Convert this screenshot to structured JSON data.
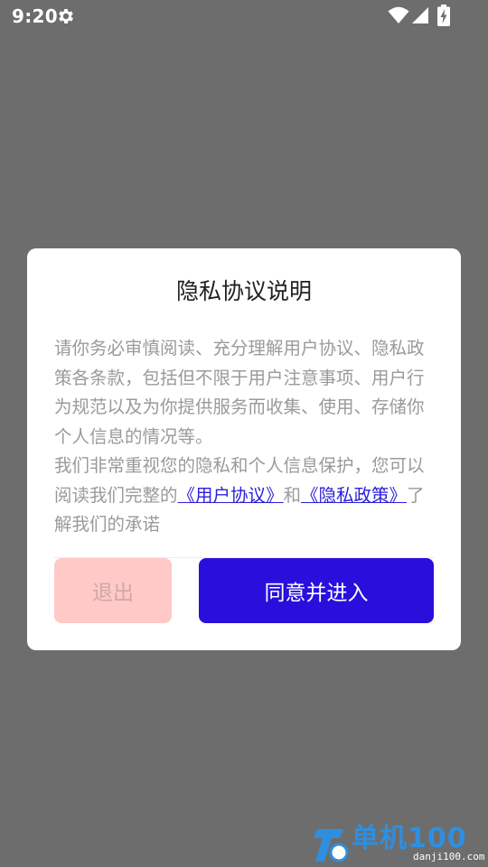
{
  "status_bar": {
    "time": "9:20",
    "icons": [
      "gear-icon",
      "wifi-icon",
      "signal-icon",
      "battery-charging-icon"
    ]
  },
  "dialog": {
    "title": "隐私协议说明",
    "paragraph1": "请你务必审慎阅读、充分理解用户协议、隐私政策各条款，包括但不限于用户注意事项、用户行为规范以及为你提供服务而收集、使用、存储你个人信息的情况等。",
    "paragraph2_prefix": "我们非常重视您的隐私和个人信息保护，您可以阅读我们完整的",
    "link_user_agreement": "《用户协议》",
    "paragraph2_and": "和",
    "link_privacy_policy": "《隐私政策》",
    "paragraph2_suffix": "了解我们的承诺",
    "exit_label": "退出",
    "agree_label": "同意并进入"
  },
  "watermark": {
    "text": "单机100",
    "url": "danji100.com"
  },
  "colors": {
    "overlay": "#6d6d6d",
    "primary": "#2a0fdc",
    "exit_bg": "#ffc9c7",
    "link": "#2a1fd9",
    "body_text": "#9a9a9a"
  }
}
